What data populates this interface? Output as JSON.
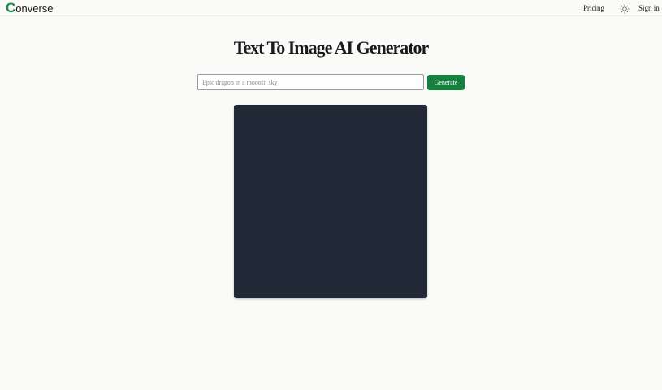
{
  "header": {
    "logo_initial": "C",
    "logo_rest": "onverse",
    "pricing_label": "Pricing",
    "theme_toggle_icon": "sun-icon",
    "signin_label": "Sign in"
  },
  "main": {
    "title": "Text To Image AI Generator",
    "prompt": {
      "value": "",
      "placeholder": "Epic dragon in a moonlit sky"
    },
    "generate_label": "Generate",
    "image_placeholder_color": "#212936"
  },
  "colors": {
    "brand": "#1d8a50",
    "button": "#16803f",
    "background": "#fafaf8"
  }
}
